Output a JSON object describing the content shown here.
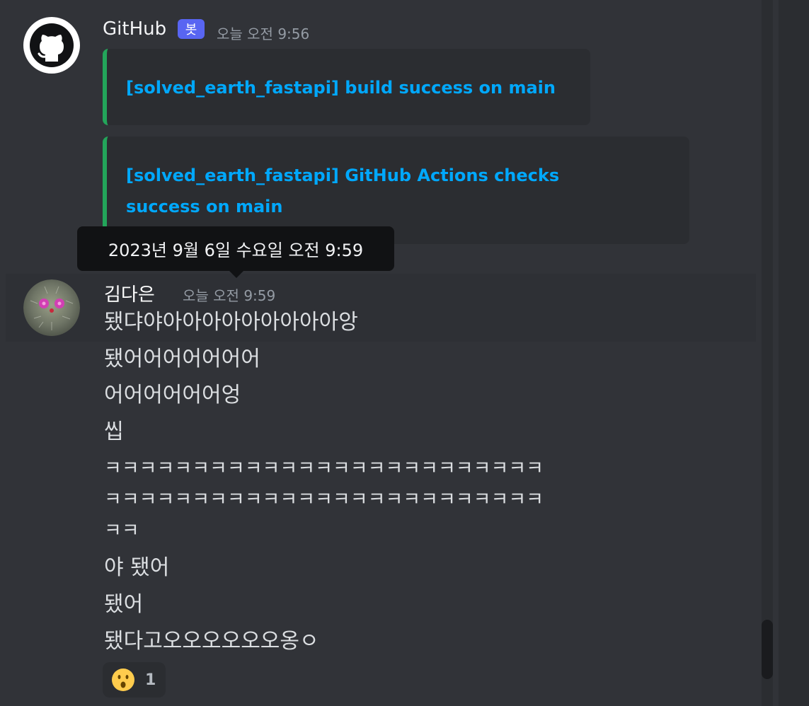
{
  "messages": [
    {
      "author": "GitHub",
      "bot_tag": "봇",
      "timestamp": "오늘 오전 9:56",
      "avatar_icon": "github-octocat-icon",
      "embeds": [
        {
          "title": "[solved_earth_fastapi] build success on main",
          "accent": "#23a55a"
        },
        {
          "title_line1": "[solved_earth_fastapi] GitHub Actions checks",
          "title_line2": "success on main",
          "accent": "#23a55a"
        }
      ]
    },
    {
      "author": "김다은",
      "timestamp": "오늘 오전 9:59",
      "timestamp_tooltip": "2023년 9월 6일 수요일 오전 9:59",
      "avatar_icon": "cactus-avatar",
      "lines": [
        "됐댜야아아아아아아아아아앙",
        "됐어어어어어어어",
        "어어어어어어엉",
        "씹",
        "ㅋㅋㅋㅋㅋㅋㅋㅋㅋㅋㅋㅋㅋㅋㅋㅋㅋㅋㅋㅋㅋㅋㅋㅋㅋ",
        "ㅋㅋㅋㅋㅋㅋㅋㅋㅋㅋㅋㅋㅋㅋㅋㅋㅋㅋㅋㅋㅋㅋㅋㅋㅋ",
        "ㅋㅋ",
        "야 됐어",
        "됐어",
        "됐다고오오오오오오옹ㅇ"
      ],
      "reaction": {
        "emoji_icon": "hushed-face-emoji",
        "count": "1"
      }
    }
  ],
  "colors": {
    "background": "#313338",
    "embed_bg": "#2b2d31",
    "link": "#00a8fc",
    "success": "#23a55a",
    "bot_tag": "#5865f2"
  }
}
